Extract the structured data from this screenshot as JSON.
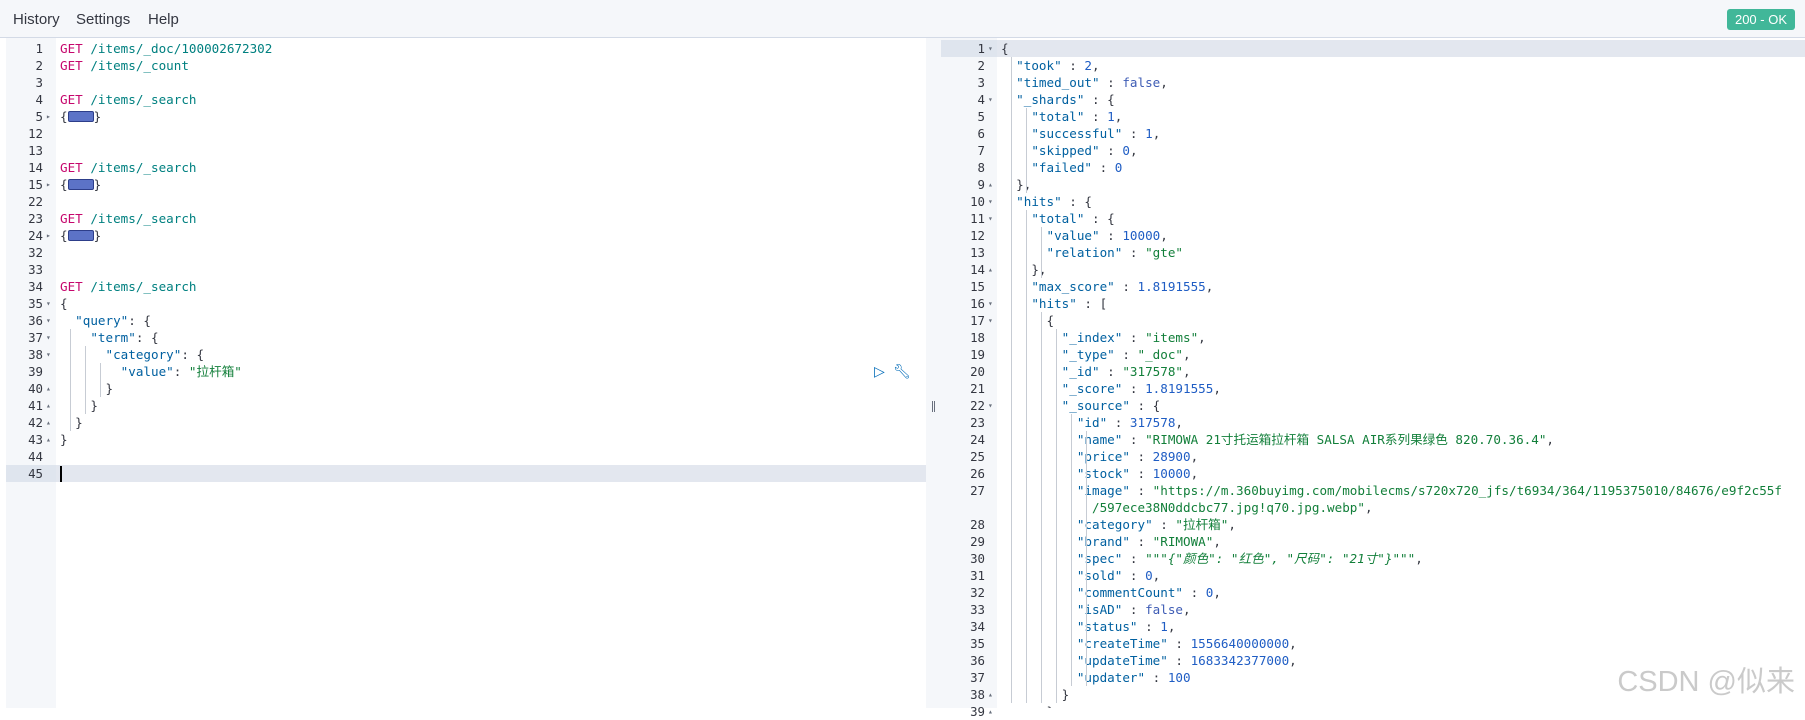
{
  "menu": {
    "history": "History",
    "settings": "Settings",
    "help": "Help"
  },
  "status": "200 - OK",
  "watermark": "CSDN @似来",
  "request": {
    "lines": [
      {
        "n": "1",
        "t": [
          [
            "m",
            "GET "
          ],
          [
            "u",
            "/items/_doc/100002672302"
          ]
        ]
      },
      {
        "n": "2",
        "t": [
          [
            "m",
            "GET "
          ],
          [
            "u",
            "/items/_count"
          ]
        ]
      },
      {
        "n": "3",
        "t": []
      },
      {
        "n": "4",
        "t": [
          [
            "m",
            "GET "
          ],
          [
            "u",
            "/items/_search"
          ]
        ]
      },
      {
        "n": "5",
        "f": "▸",
        "t": [
          [
            "p",
            "{"
          ],
          [
            "ph",
            ""
          ],
          [
            "p",
            "}"
          ]
        ]
      },
      {
        "n": "12",
        "t": []
      },
      {
        "n": "13",
        "t": []
      },
      {
        "n": "14",
        "t": [
          [
            "m",
            "GET "
          ],
          [
            "u",
            "/items/_search"
          ]
        ]
      },
      {
        "n": "15",
        "f": "▸",
        "t": [
          [
            "p",
            "{"
          ],
          [
            "ph",
            ""
          ],
          [
            "p",
            "}"
          ]
        ]
      },
      {
        "n": "22",
        "t": []
      },
      {
        "n": "23",
        "t": [
          [
            "m",
            "GET "
          ],
          [
            "u",
            "/items/_search"
          ]
        ]
      },
      {
        "n": "24",
        "f": "▸",
        "t": [
          [
            "p",
            "{"
          ],
          [
            "ph",
            ""
          ],
          [
            "p",
            "}"
          ]
        ]
      },
      {
        "n": "32",
        "t": []
      },
      {
        "n": "33",
        "t": []
      },
      {
        "n": "34",
        "t": [
          [
            "m",
            "GET "
          ],
          [
            "u",
            "/items/_search"
          ]
        ]
      },
      {
        "n": "35",
        "f": "▾",
        "t": [
          [
            "p",
            "{"
          ]
        ]
      },
      {
        "n": "36",
        "f": "▾",
        "t": [
          [
            "p",
            "  "
          ],
          [
            "k",
            "\"query\""
          ],
          [
            "p",
            ": {"
          ]
        ]
      },
      {
        "n": "37",
        "f": "▾",
        "t": [
          [
            "p",
            "    "
          ],
          [
            "k",
            "\"term\""
          ],
          [
            "p",
            ": {"
          ]
        ]
      },
      {
        "n": "38",
        "f": "▾",
        "t": [
          [
            "p",
            "      "
          ],
          [
            "k",
            "\"category\""
          ],
          [
            "p",
            ": {"
          ]
        ]
      },
      {
        "n": "39",
        "t": [
          [
            "p",
            "        "
          ],
          [
            "k",
            "\"value\""
          ],
          [
            "p",
            ": "
          ],
          [
            "s",
            "\"拉杆箱\""
          ]
        ]
      },
      {
        "n": "40",
        "f": "▴",
        "t": [
          [
            "p",
            "      }"
          ]
        ]
      },
      {
        "n": "41",
        "f": "▴",
        "t": [
          [
            "p",
            "    }"
          ]
        ]
      },
      {
        "n": "42",
        "f": "▴",
        "t": [
          [
            "p",
            "  }"
          ]
        ]
      },
      {
        "n": "43",
        "f": "▴",
        "t": [
          [
            "p",
            "}"
          ]
        ]
      },
      {
        "n": "44",
        "t": []
      },
      {
        "n": "45",
        "t": [],
        "active": true
      }
    ]
  },
  "response": {
    "lines": [
      {
        "n": "1",
        "f": "▾",
        "t": [
          [
            "p",
            "{"
          ]
        ],
        "active": true
      },
      {
        "n": "2",
        "t": [
          [
            "p",
            "  "
          ],
          [
            "k",
            "\"took\""
          ],
          [
            "p",
            " : "
          ],
          [
            "n",
            "2"
          ],
          [
            "p",
            ","
          ]
        ]
      },
      {
        "n": "3",
        "t": [
          [
            "p",
            "  "
          ],
          [
            "k",
            "\"timed_out\""
          ],
          [
            "p",
            " : "
          ],
          [
            "b",
            "false"
          ],
          [
            "p",
            ","
          ]
        ]
      },
      {
        "n": "4",
        "f": "▾",
        "t": [
          [
            "p",
            "  "
          ],
          [
            "k",
            "\"_shards\""
          ],
          [
            "p",
            " : {"
          ]
        ]
      },
      {
        "n": "5",
        "t": [
          [
            "p",
            "    "
          ],
          [
            "k",
            "\"total\""
          ],
          [
            "p",
            " : "
          ],
          [
            "n",
            "1"
          ],
          [
            "p",
            ","
          ]
        ]
      },
      {
        "n": "6",
        "t": [
          [
            "p",
            "    "
          ],
          [
            "k",
            "\"successful\""
          ],
          [
            "p",
            " : "
          ],
          [
            "n",
            "1"
          ],
          [
            "p",
            ","
          ]
        ]
      },
      {
        "n": "7",
        "t": [
          [
            "p",
            "    "
          ],
          [
            "k",
            "\"skipped\""
          ],
          [
            "p",
            " : "
          ],
          [
            "n",
            "0"
          ],
          [
            "p",
            ","
          ]
        ]
      },
      {
        "n": "8",
        "t": [
          [
            "p",
            "    "
          ],
          [
            "k",
            "\"failed\""
          ],
          [
            "p",
            " : "
          ],
          [
            "n",
            "0"
          ]
        ]
      },
      {
        "n": "9",
        "f": "▴",
        "t": [
          [
            "p",
            "  },"
          ]
        ]
      },
      {
        "n": "10",
        "f": "▾",
        "t": [
          [
            "p",
            "  "
          ],
          [
            "k",
            "\"hits\""
          ],
          [
            "p",
            " : {"
          ]
        ]
      },
      {
        "n": "11",
        "f": "▾",
        "t": [
          [
            "p",
            "    "
          ],
          [
            "k",
            "\"total\""
          ],
          [
            "p",
            " : {"
          ]
        ]
      },
      {
        "n": "12",
        "t": [
          [
            "p",
            "      "
          ],
          [
            "k",
            "\"value\""
          ],
          [
            "p",
            " : "
          ],
          [
            "n",
            "10000"
          ],
          [
            "p",
            ","
          ]
        ]
      },
      {
        "n": "13",
        "t": [
          [
            "p",
            "      "
          ],
          [
            "k",
            "\"relation\""
          ],
          [
            "p",
            " : "
          ],
          [
            "s",
            "\"gte\""
          ]
        ]
      },
      {
        "n": "14",
        "f": "▴",
        "t": [
          [
            "p",
            "    },"
          ]
        ]
      },
      {
        "n": "15",
        "t": [
          [
            "p",
            "    "
          ],
          [
            "k",
            "\"max_score\""
          ],
          [
            "p",
            " : "
          ],
          [
            "n",
            "1.8191555"
          ],
          [
            "p",
            ","
          ]
        ]
      },
      {
        "n": "16",
        "f": "▾",
        "t": [
          [
            "p",
            "    "
          ],
          [
            "k",
            "\"hits\""
          ],
          [
            "p",
            " : ["
          ]
        ]
      },
      {
        "n": "17",
        "f": "▾",
        "t": [
          [
            "p",
            "      {"
          ]
        ]
      },
      {
        "n": "18",
        "t": [
          [
            "p",
            "        "
          ],
          [
            "k",
            "\"_index\""
          ],
          [
            "p",
            " : "
          ],
          [
            "s",
            "\"items\""
          ],
          [
            "p",
            ","
          ]
        ]
      },
      {
        "n": "19",
        "t": [
          [
            "p",
            "        "
          ],
          [
            "k",
            "\"_type\""
          ],
          [
            "p",
            " : "
          ],
          [
            "s",
            "\"_doc\""
          ],
          [
            "p",
            ","
          ]
        ]
      },
      {
        "n": "20",
        "t": [
          [
            "p",
            "        "
          ],
          [
            "k",
            "\"_id\""
          ],
          [
            "p",
            " : "
          ],
          [
            "s",
            "\"317578\""
          ],
          [
            "p",
            ","
          ]
        ]
      },
      {
        "n": "21",
        "t": [
          [
            "p",
            "        "
          ],
          [
            "k",
            "\"_score\""
          ],
          [
            "p",
            " : "
          ],
          [
            "n",
            "1.8191555"
          ],
          [
            "p",
            ","
          ]
        ]
      },
      {
        "n": "22",
        "f": "▾",
        "t": [
          [
            "p",
            "        "
          ],
          [
            "k",
            "\"_source\""
          ],
          [
            "p",
            " : {"
          ]
        ]
      },
      {
        "n": "23",
        "t": [
          [
            "p",
            "          "
          ],
          [
            "k",
            "\"id\""
          ],
          [
            "p",
            " : "
          ],
          [
            "n",
            "317578"
          ],
          [
            "p",
            ","
          ]
        ]
      },
      {
        "n": "24",
        "t": [
          [
            "p",
            "          "
          ],
          [
            "k",
            "\"name\""
          ],
          [
            "p",
            " : "
          ],
          [
            "s",
            "\"RIMOWA 21寸托运箱拉杆箱 SALSA AIR系列果绿色 820.70.36.4\""
          ],
          [
            "p",
            ","
          ]
        ]
      },
      {
        "n": "25",
        "t": [
          [
            "p",
            "          "
          ],
          [
            "k",
            "\"price\""
          ],
          [
            "p",
            " : "
          ],
          [
            "n",
            "28900"
          ],
          [
            "p",
            ","
          ]
        ]
      },
      {
        "n": "26",
        "t": [
          [
            "p",
            "          "
          ],
          [
            "k",
            "\"stock\""
          ],
          [
            "p",
            " : "
          ],
          [
            "n",
            "10000"
          ],
          [
            "p",
            ","
          ]
        ]
      },
      {
        "n": "27",
        "t": [
          [
            "p",
            "          "
          ],
          [
            "k",
            "\"image\""
          ],
          [
            "p",
            " : "
          ],
          [
            "s",
            "\"https://m.360buyimg.com/mobilecms/s720x720_jfs/t6934/364/1195375010/84676/e9f2c55f"
          ]
        ]
      },
      {
        "n": "",
        "t": [
          [
            "s",
            "            /597ece38N0ddcbc77.jpg!q70.jpg.webp\""
          ],
          [
            "p",
            ","
          ]
        ]
      },
      {
        "n": "28",
        "t": [
          [
            "p",
            "          "
          ],
          [
            "k",
            "\"category\""
          ],
          [
            "p",
            " : "
          ],
          [
            "s",
            "\"拉杆箱\""
          ],
          [
            "p",
            ","
          ]
        ]
      },
      {
        "n": "29",
        "t": [
          [
            "p",
            "          "
          ],
          [
            "k",
            "\"brand\""
          ],
          [
            "p",
            " : "
          ],
          [
            "s",
            "\"RIMOWA\""
          ],
          [
            "p",
            ","
          ]
        ]
      },
      {
        "n": "30",
        "t": [
          [
            "p",
            "          "
          ],
          [
            "k",
            "\"spec\""
          ],
          [
            "p",
            " : "
          ],
          [
            "s",
            "\"\"\""
          ],
          [
            "i",
            "{\"颜色\": \"红色\", \"尺码\": \"21寸\"}"
          ],
          [
            "s",
            "\"\"\""
          ],
          [
            "p",
            ","
          ]
        ]
      },
      {
        "n": "31",
        "t": [
          [
            "p",
            "          "
          ],
          [
            "k",
            "\"sold\""
          ],
          [
            "p",
            " : "
          ],
          [
            "n",
            "0"
          ],
          [
            "p",
            ","
          ]
        ]
      },
      {
        "n": "32",
        "t": [
          [
            "p",
            "          "
          ],
          [
            "k",
            "\"commentCount\""
          ],
          [
            "p",
            " : "
          ],
          [
            "n",
            "0"
          ],
          [
            "p",
            ","
          ]
        ]
      },
      {
        "n": "33",
        "t": [
          [
            "p",
            "          "
          ],
          [
            "k",
            "\"isAD\""
          ],
          [
            "p",
            " : "
          ],
          [
            "b",
            "false"
          ],
          [
            "p",
            ","
          ]
        ]
      },
      {
        "n": "34",
        "t": [
          [
            "p",
            "          "
          ],
          [
            "k",
            "\"status\""
          ],
          [
            "p",
            " : "
          ],
          [
            "n",
            "1"
          ],
          [
            "p",
            ","
          ]
        ]
      },
      {
        "n": "35",
        "t": [
          [
            "p",
            "          "
          ],
          [
            "k",
            "\"createTime\""
          ],
          [
            "p",
            " : "
          ],
          [
            "n",
            "1556640000000"
          ],
          [
            "p",
            ","
          ]
        ]
      },
      {
        "n": "36",
        "t": [
          [
            "p",
            "          "
          ],
          [
            "k",
            "\"updateTime\""
          ],
          [
            "p",
            " : "
          ],
          [
            "n",
            "1683342377000"
          ],
          [
            "p",
            ","
          ]
        ]
      },
      {
        "n": "37",
        "t": [
          [
            "p",
            "          "
          ],
          [
            "k",
            "\"updater\""
          ],
          [
            "p",
            " : "
          ],
          [
            "n",
            "100"
          ]
        ]
      },
      {
        "n": "38",
        "f": "▴",
        "t": [
          [
            "p",
            "        }"
          ]
        ]
      },
      {
        "n": "39",
        "f": "▴",
        "t": [
          [
            "p",
            "      }"
          ]
        ]
      }
    ]
  }
}
